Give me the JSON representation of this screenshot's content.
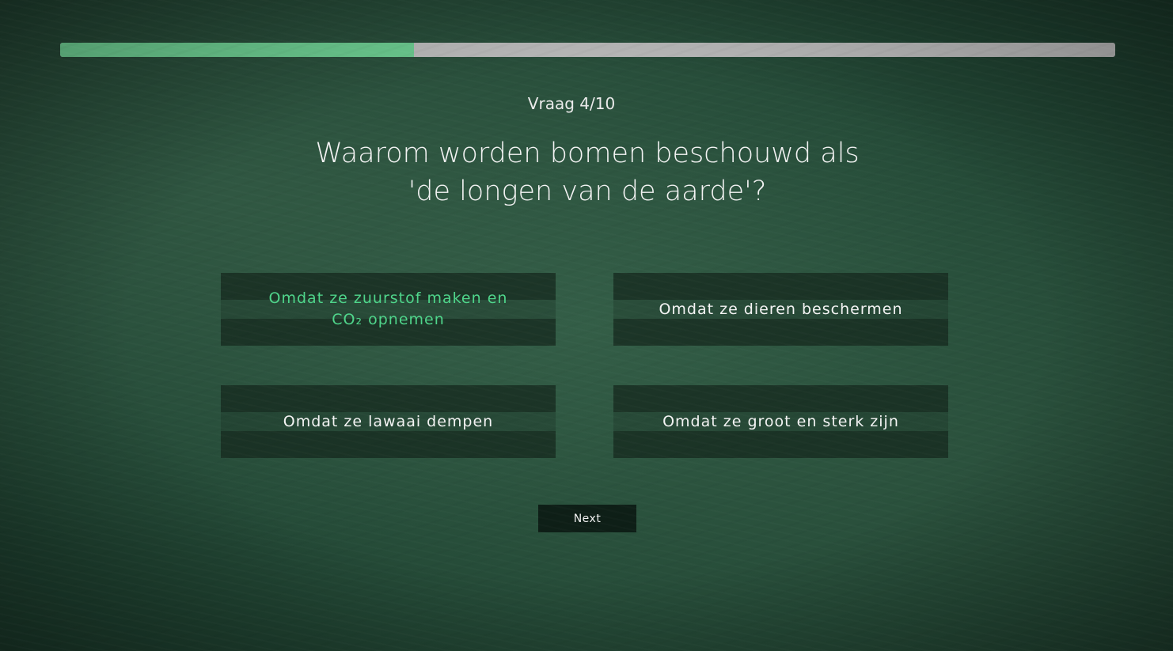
{
  "progress": {
    "current": 4,
    "total": 10,
    "fraction": 0.335,
    "fill_color": "#6bca8f",
    "track_color": "#b9b9b9"
  },
  "question": {
    "counter": "Vraag 4/10",
    "line1": "Waarom worden bomen beschouwd als",
    "line2": "'de longen van de aarde'?"
  },
  "options": [
    {
      "label": "Omdat ze zuurstof maken en CO₂ opnemen",
      "selected": true
    },
    {
      "label": "Omdat ze dieren beschermen",
      "selected": false
    },
    {
      "label": "Omdat ze lawaai dempen",
      "selected": false
    },
    {
      "label": "Omdat ze groot en sterk zijn",
      "selected": false
    }
  ],
  "next_label": "Next",
  "colors": {
    "background": "#2a5240",
    "selected_text": "#4fd68b",
    "button": "#0e1f17"
  }
}
